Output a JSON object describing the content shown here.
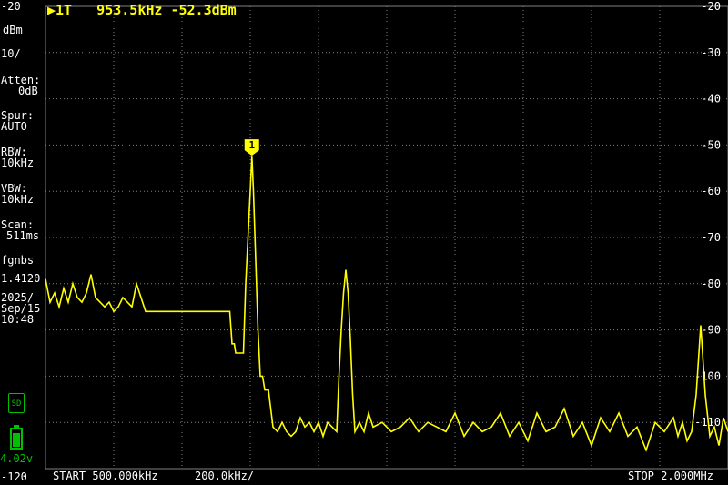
{
  "marker": {
    "readout": "▶1T   953.5kHz -52.3dBm",
    "flag_label": "1"
  },
  "sidebar": {
    "ref_top": "-20",
    "unit": "dBm",
    "scale": "10/",
    "atten_label": "Atten:",
    "atten_value": "0dB",
    "spur_label": "Spur:",
    "spur_value": "AUTO",
    "rbw_label": "RBW:",
    "rbw_value": "10kHz",
    "vbw_label": "VBW:",
    "vbw_value": "10kHz",
    "scan_label": "Scan:",
    "scan_value": "511ms",
    "device": "fgnbs",
    "version": "1.4120",
    "date_year": "2025/",
    "date_month_day": "Sep/15",
    "time": "10:48",
    "battery_voltage": "4.02v",
    "ref_bottom": "-120"
  },
  "footer": {
    "start": "START 500.000kHz",
    "span_div": "200.0kHz/",
    "stop": "STOP 2.000MHz"
  },
  "colors": {
    "trace": "#ffff00",
    "grid": "#808080",
    "status_green": "#00c000"
  },
  "icons": {
    "sd": "sd-card-icon",
    "battery": "battery-icon"
  },
  "battery_level": 0.75,
  "chart_data": {
    "type": "line",
    "xlabel": "",
    "ylabel": "",
    "xlim_hz": [
      500000,
      2000000
    ],
    "ylim_dbm": [
      -120,
      -20
    ],
    "y_ticks": [
      "-20",
      "-30",
      "-40",
      "-50",
      "-60",
      "-70",
      "-80",
      "-90",
      "-100",
      "-110"
    ],
    "marker": {
      "x_hz": 953500,
      "y_dbm": -52.3
    },
    "series": [
      {
        "x_hz": [
          500000,
          510000,
          520000,
          530000,
          540000,
          550000,
          560000,
          570000,
          580000,
          590000,
          600000,
          610000,
          620000,
          630000,
          640000,
          650000,
          660000,
          670000,
          680000,
          690000,
          700000,
          720000,
          740000,
          760000,
          780000,
          800000,
          820000,
          840000,
          860000,
          880000,
          900000,
          905000,
          910000,
          915000,
          918000,
          925000,
          930000,
          935000,
          940000,
          945000,
          950000,
          953500,
          957000,
          962000,
          967000,
          972000,
          977000,
          982000,
          990000,
          1000000,
          1010000,
          1020000,
          1030000,
          1040000,
          1050000,
          1060000,
          1070000,
          1080000,
          1090000,
          1100000,
          1110000,
          1120000,
          1130000,
          1140000,
          1145000,
          1150000,
          1155000,
          1160000,
          1165000,
          1170000,
          1175000,
          1180000,
          1190000,
          1200000,
          1210000,
          1220000,
          1240000,
          1260000,
          1280000,
          1300000,
          1320000,
          1340000,
          1360000,
          1380000,
          1400000,
          1420000,
          1440000,
          1460000,
          1480000,
          1500000,
          1520000,
          1540000,
          1560000,
          1580000,
          1600000,
          1620000,
          1640000,
          1660000,
          1680000,
          1700000,
          1720000,
          1740000,
          1760000,
          1780000,
          1800000,
          1820000,
          1840000,
          1860000,
          1880000,
          1890000,
          1900000,
          1910000,
          1920000,
          1930000,
          1940000,
          1950000,
          1960000,
          1970000,
          1980000,
          1990000,
          2000000
        ],
        "y_dbm": [
          -79,
          -84,
          -82,
          -85,
          -81,
          -84,
          -80,
          -83,
          -84,
          -82,
          -78,
          -83,
          -84,
          -85,
          -84,
          -86,
          -85,
          -83,
          -84,
          -85,
          -80,
          -86,
          -86,
          -86,
          -86,
          -86,
          -86,
          -86,
          -86,
          -86,
          -86,
          -86,
          -93,
          -93,
          -95,
          -95,
          -95,
          -95,
          -80,
          -70,
          -60,
          -52.3,
          -60,
          -75,
          -90,
          -100,
          -100,
          -103,
          -103,
          -111,
          -112,
          -110,
          -112,
          -113,
          -112,
          -109,
          -111,
          -110,
          -112,
          -110,
          -113,
          -110,
          -111,
          -112,
          -100,
          -90,
          -82,
          -77,
          -82,
          -92,
          -104,
          -112,
          -110,
          -112,
          -108,
          -111,
          -110,
          -112,
          -111,
          -109,
          -112,
          -110,
          -111,
          -112,
          -108,
          -113,
          -110,
          -112,
          -111,
          -108,
          -113,
          -110,
          -114,
          -108,
          -112,
          -111,
          -107,
          -113,
          -110,
          -115,
          -109,
          -112,
          -108,
          -113,
          -111,
          -116,
          -110,
          -112,
          -109,
          -113,
          -110,
          -114,
          -112,
          -104,
          -89,
          -104,
          -113,
          -111,
          -115,
          -109,
          -112,
          -116,
          -111,
          -113,
          -117
        ]
      }
    ]
  }
}
